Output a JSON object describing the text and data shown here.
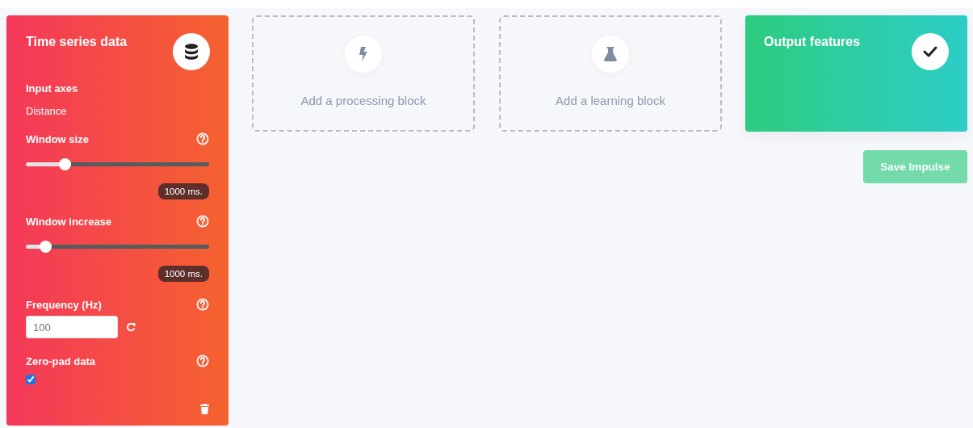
{
  "input_block": {
    "title": "Time series data",
    "axes_label": "Input axes",
    "axes": [
      "Distance"
    ],
    "fields": [
      {
        "kind": "slider",
        "label": "Window size",
        "level": 0.21,
        "reading": "1000 ms."
      },
      {
        "kind": "slider",
        "label": "Window increase",
        "level": 0.105,
        "reading": "1000 ms."
      },
      {
        "kind": "number",
        "label": "Frequency (Hz)",
        "value": "100"
      },
      {
        "kind": "checkbox",
        "label": "Zero-pad data",
        "checked": true
      }
    ]
  },
  "empty_blocks": [
    {
      "kind": "processing",
      "label": "Add a processing block"
    },
    {
      "kind": "learning",
      "label": "Add a learning block"
    }
  ],
  "output_block": {
    "title": "Output features"
  },
  "save_button": {
    "label": "Save Impulse",
    "disabled": true
  }
}
